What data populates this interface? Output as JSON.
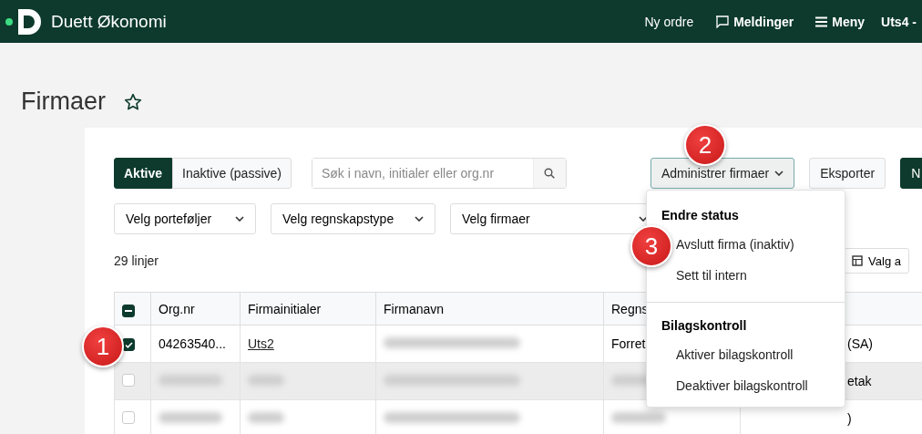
{
  "header": {
    "brand": "Duett Økonomi",
    "nav": [
      {
        "label": "Ny ordre"
      },
      {
        "label": "Meldinger"
      },
      {
        "label": "Meny"
      }
    ],
    "user": "Uts4 -"
  },
  "page": {
    "title": "Firmaer",
    "favorite": false
  },
  "status_tabs": [
    {
      "label": "Aktive",
      "selected": true
    },
    {
      "label": "Inaktive (passive)",
      "selected": false
    }
  ],
  "search": {
    "placeholder": "Søk i navn, initialer eller org.nr"
  },
  "actions": [
    {
      "label": "Administrer firmaer",
      "kind": "dropdown",
      "expanded": true
    },
    {
      "label": "Eksporter",
      "kind": "plain"
    },
    {
      "label": "N",
      "kind": "primary"
    }
  ],
  "filters": [
    "Velg porteføljer",
    "Velg regnskapstype",
    "Velg firmaer"
  ],
  "row_count": "29 linjer",
  "view_button": "Valg a",
  "table": {
    "header_indeterminate": true,
    "columns": [
      "Org.nr",
      "Firmainitialer",
      "Firmanavn",
      "Regns"
    ],
    "rows": [
      {
        "checked": true,
        "highlighted": false,
        "cells": [
          {
            "text": "04263540..."
          },
          {
            "text": "Uts2",
            "link": true
          },
          {
            "blurred": true
          },
          {
            "text": "Forret"
          },
          {
            "text": "(SA)"
          }
        ]
      },
      {
        "checked": false,
        "highlighted": true,
        "cells": [
          {
            "blurred": true
          },
          {
            "blurred": true
          },
          {
            "blurred": true
          },
          {
            "blurred": true
          },
          {
            "text": "etak"
          }
        ]
      },
      {
        "checked": false,
        "highlighted": false,
        "cells": [
          {
            "blurred": true
          },
          {
            "blurred": true
          },
          {
            "blurred": true
          },
          {
            "blurred": true
          },
          {
            "text": ")"
          }
        ]
      }
    ]
  },
  "menu": {
    "sections": [
      {
        "heading": "Endre status",
        "items": [
          "Avslutt firma (inaktiv)",
          "Sett til intern"
        ]
      },
      {
        "heading": "Bilagskontroll",
        "items": [
          "Aktiver bilagskontroll",
          "Deaktiver bilagskontroll"
        ]
      }
    ]
  },
  "annotations": [
    {
      "number": "1"
    },
    {
      "number": "2"
    },
    {
      "number": "3"
    }
  ]
}
